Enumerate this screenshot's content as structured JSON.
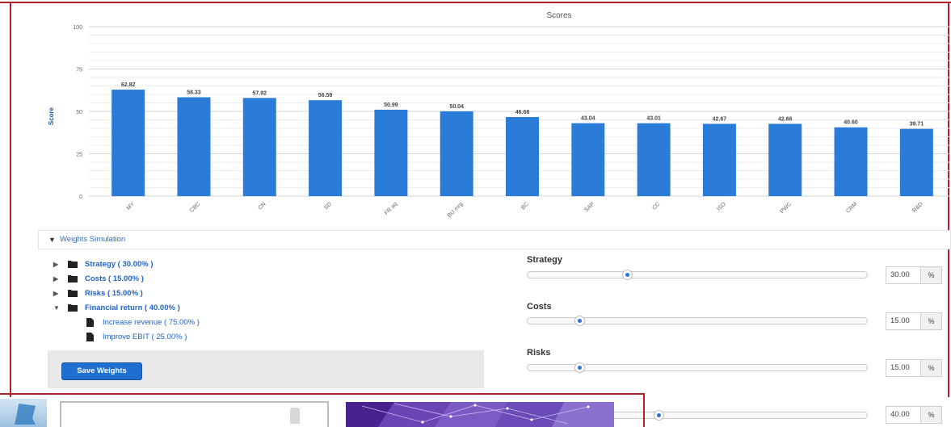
{
  "chart_data": {
    "type": "bar",
    "title": "Scores",
    "xlabel": "",
    "ylabel": "Score",
    "ylim": [
      0,
      100
    ],
    "yticks": [
      0,
      25,
      50,
      75,
      100
    ],
    "grid": true,
    "legend": "none",
    "categories": [
      "MY",
      "CBC",
      "CN",
      "SD",
      "FR aq",
      "BU mrg",
      "BC",
      "SAP",
      "CC",
      "ISO",
      "PWC",
      "CRM",
      "R&D"
    ],
    "values": [
      62.82,
      58.33,
      57.92,
      56.59,
      50.99,
      50.04,
      46.68,
      43.04,
      43.01,
      42.67,
      42.66,
      40.6,
      39.71
    ],
    "data_labels": [
      "62.82",
      "58.33",
      "57.92",
      "56.59",
      "50.99",
      "50.04",
      "46.68",
      "43.04",
      "43.01",
      "42.67",
      "42.66",
      "40.60",
      "39.71"
    ],
    "bar_color": "#2b7bd9"
  },
  "weights_simulation": {
    "title": "Weights Simulation",
    "tree": [
      {
        "label": "Strategy ( 30.00% )"
      },
      {
        "label": "Costs ( 15.00% )"
      },
      {
        "label": "Risks ( 15.00% )"
      },
      {
        "label": "Financial return ( 40.00% )"
      }
    ],
    "leaves": [
      {
        "label": "Increase revenue ( 75.00% )"
      },
      {
        "label": "Improve EBIT ( 25.00% )"
      }
    ],
    "save_label": "Save Weights",
    "sliders": [
      {
        "label": "Strategy",
        "value": "30.00",
        "unit": "%",
        "fraction": 0.3
      },
      {
        "label": "Costs",
        "value": "15.00",
        "unit": "%",
        "fraction": 0.15
      },
      {
        "label": "Risks",
        "value": "15.00",
        "unit": "%",
        "fraction": 0.15
      },
      {
        "label": "",
        "value": "40.00",
        "unit": "%",
        "fraction": 0.4
      }
    ]
  },
  "colors": {
    "accent": "#1f6fd0",
    "frame": "#b02028",
    "link": "#1f63c6"
  }
}
